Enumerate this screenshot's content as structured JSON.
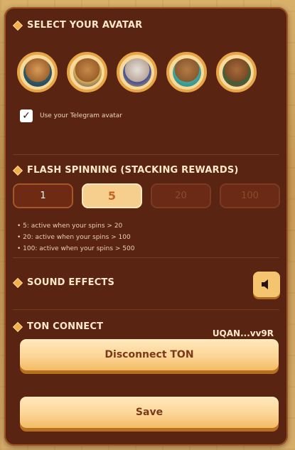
{
  "sections": {
    "avatar": {
      "title": "SELECT YOUR AVATAR",
      "avatars": [
        "cat-pharaoh-avatar-1",
        "cat-pharaoh-avatar-2",
        "cat-pharaoh-avatar-3",
        "cat-pharaoh-avatar-4",
        "cat-pharaoh-avatar-5"
      ],
      "telegram_checkbox": {
        "label": "Use your Telegram avatar",
        "checked": true
      }
    },
    "flash": {
      "title": "FLASH SPINNING (STACKING REWARDS)",
      "options": [
        "1",
        "5",
        "20",
        "100"
      ],
      "selected": "5",
      "notes": [
        "5: active when your spins > 20",
        "20: active when your spins > 100",
        "100: active when your spins > 500"
      ]
    },
    "sound": {
      "title": "SOUND EFFECTS",
      "icon": "speaker-icon"
    },
    "ton": {
      "title": "TON CONNECT",
      "wallet": "UQAN...vv9R",
      "disconnect_label": "Disconnect TON"
    }
  },
  "save_label": "Save",
  "colors": {
    "panel": "#5a2412",
    "accent": "#f3b048",
    "button": "#fcd596"
  }
}
